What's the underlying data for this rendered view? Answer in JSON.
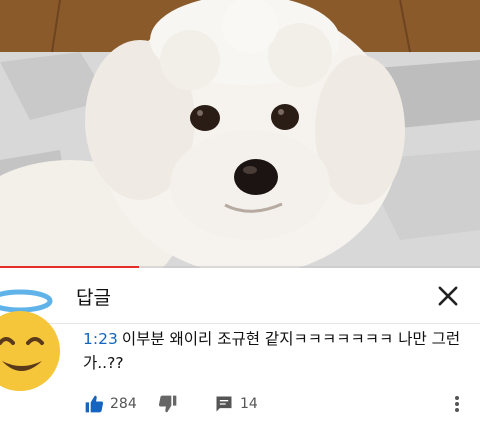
{
  "panel": {
    "title": "답글",
    "comment": {
      "timestamp": "1:23",
      "text": "이부분 왜이리 조규현 같지ㅋㅋㅋㅋㅋㅋㅋ 나만 그런 가..??"
    },
    "likes": "284",
    "replies": "14"
  },
  "video": {
    "progress": 0.29
  },
  "icons": {
    "close": "close-icon",
    "like": "thumbs-up-icon",
    "dislike": "thumbs-down-icon",
    "reply": "comment-icon",
    "more": "more-vert-icon",
    "avatar": "smiling-face-with-halo-emoji"
  },
  "colors": {
    "accent": "#1565c0",
    "progress": "#e52d27"
  }
}
